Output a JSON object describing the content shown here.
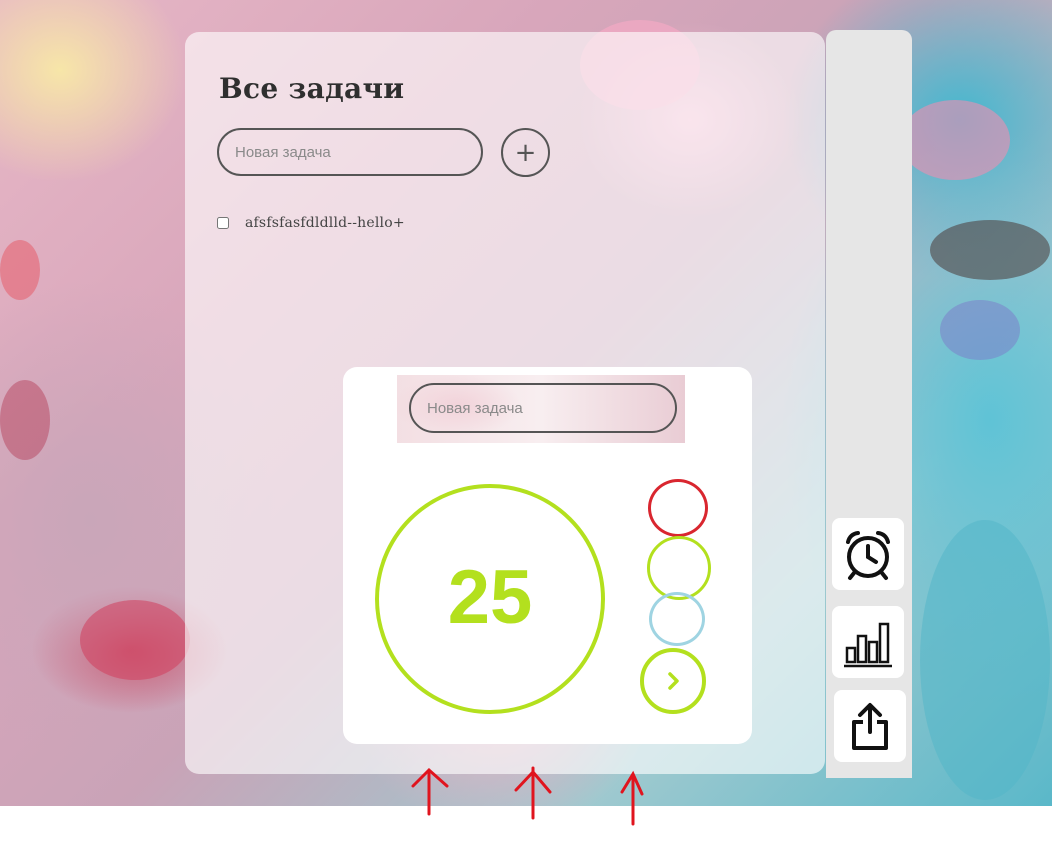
{
  "tasks_panel": {
    "title": "Все задачи",
    "new_task_placeholder": "Новая задача",
    "add_button_label": "+",
    "tasks": [
      {
        "text": "afsfsfasfdldlld--hello+",
        "done": false
      }
    ]
  },
  "timer_popup": {
    "new_task_placeholder": "Новая задача",
    "timer_value": "25",
    "mode_colors": [
      "#d9262f",
      "#b3e01e",
      "#9fd4e2"
    ],
    "accent_color": "#b3e01e"
  },
  "side_toolbar": {
    "buttons": [
      {
        "icon": "alarm-clock-icon"
      },
      {
        "icon": "bar-chart-icon"
      },
      {
        "icon": "share-icon"
      }
    ]
  },
  "annotations": {
    "arrow_color": "#e0141e",
    "arrow_count": 3
  }
}
